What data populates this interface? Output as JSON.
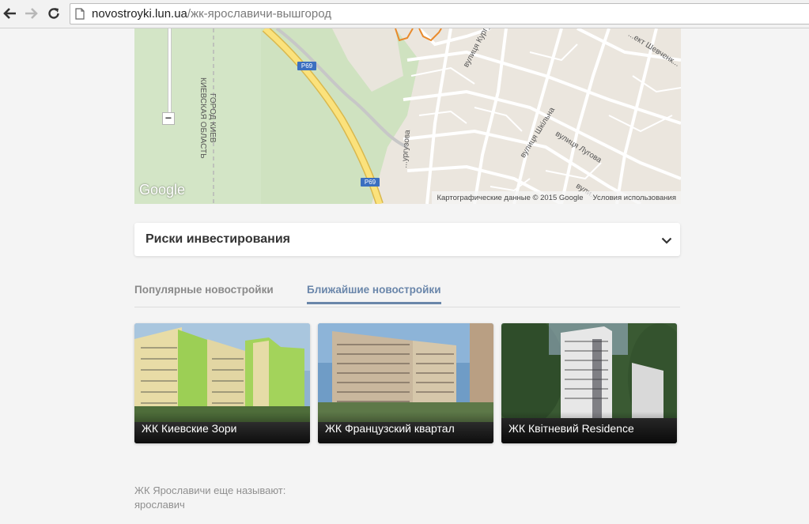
{
  "browser": {
    "url_host": "novostroyki.lun.ua",
    "url_path": "/жк-ярославичи-вышгород"
  },
  "map": {
    "attribution": "Картографические данные © 2015 Google",
    "terms": "Условия использования",
    "logo": "Google",
    "zoom_out": "−",
    "road_shields": [
      "P69",
      "P69"
    ],
    "labels": {
      "region": "КИЕВСКАЯ ОБЛАСТЬ",
      "city": "ГОРОД КИЕВ",
      "street1": "вулиця Кургу...",
      "street2": "вулиця Шкільна",
      "street3": "вулиця Лугова",
      "street4": "...ект Шевченк...",
      "street5": "...ургузова",
      "street6": "вули..."
    }
  },
  "accordion": {
    "title": "Риски инвестирования"
  },
  "tabs": [
    {
      "label": "Популярные новостройки",
      "active": false
    },
    {
      "label": "Ближайшие новостройки",
      "active": true
    }
  ],
  "cards": [
    {
      "title": "ЖК Киевские Зори"
    },
    {
      "title": "ЖК Французский квартал"
    },
    {
      "title": "ЖК Квітневий Residence"
    }
  ],
  "aka": {
    "label": "ЖК Ярославичи еще называют:",
    "value": "ярославич"
  },
  "colors": {
    "accent": "#6a86aa",
    "page_bg": "#f4f4f4"
  }
}
